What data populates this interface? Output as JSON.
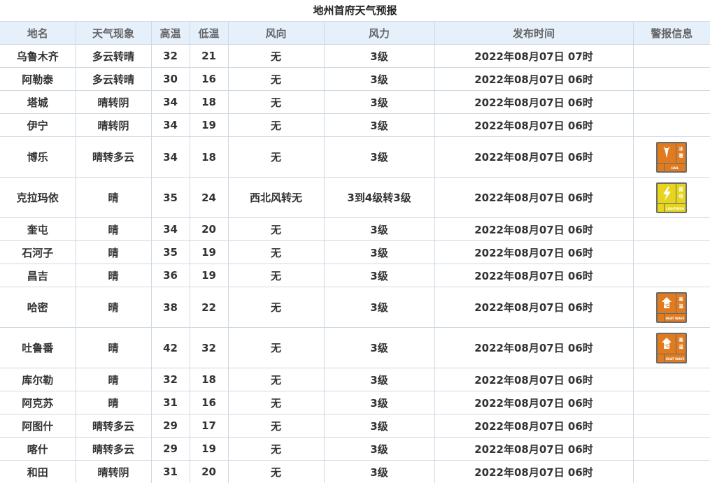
{
  "title": "地州首府天气预报",
  "columns": [
    "地名",
    "天气现象",
    "高温",
    "低温",
    "风向",
    "风力",
    "发布时间",
    "警报信息"
  ],
  "rows": [
    {
      "place": "乌鲁木齐",
      "weather": "多云转晴",
      "high": "32",
      "low": "21",
      "wind_dir": "无",
      "wind_force": "3级",
      "time": "2022年08月07日 07时",
      "alert": null
    },
    {
      "place": "阿勒泰",
      "weather": "多云转晴",
      "high": "30",
      "low": "16",
      "wind_dir": "无",
      "wind_force": "3级",
      "time": "2022年08月07日 06时",
      "alert": null
    },
    {
      "place": "塔城",
      "weather": "晴转阴",
      "high": "34",
      "low": "18",
      "wind_dir": "无",
      "wind_force": "3级",
      "time": "2022年08月07日 06时",
      "alert": null
    },
    {
      "place": "伊宁",
      "weather": "晴转阴",
      "high": "34",
      "low": "19",
      "wind_dir": "无",
      "wind_force": "3级",
      "time": "2022年08月07日 06时",
      "alert": null
    },
    {
      "place": "博乐",
      "weather": "晴转多云",
      "high": "34",
      "low": "18",
      "wind_dir": "无",
      "wind_force": "3级",
      "time": "2022年08月07日 06时",
      "alert": {
        "icon": "hail-warning-icon",
        "top": "冰雹",
        "bottom": "HAIL",
        "color": "#e07b1f"
      }
    },
    {
      "place": "克拉玛依",
      "weather": "晴",
      "high": "35",
      "low": "24",
      "wind_dir": "西北风转无",
      "wind_force": "3到4级转3级",
      "time": "2022年08月07日 06时",
      "alert": {
        "icon": "thunder-warning-icon",
        "top": "雷电",
        "bottom": "LIGHTNING",
        "color": "#e6d51c"
      }
    },
    {
      "place": "奎屯",
      "weather": "晴",
      "high": "34",
      "low": "20",
      "wind_dir": "无",
      "wind_force": "3级",
      "time": "2022年08月07日 06时",
      "alert": null
    },
    {
      "place": "石河子",
      "weather": "晴",
      "high": "35",
      "low": "19",
      "wind_dir": "无",
      "wind_force": "3级",
      "time": "2022年08月07日 06时",
      "alert": null
    },
    {
      "place": "昌吉",
      "weather": "晴",
      "high": "36",
      "low": "19",
      "wind_dir": "无",
      "wind_force": "3级",
      "time": "2022年08月07日 06时",
      "alert": null
    },
    {
      "place": "哈密",
      "weather": "晴",
      "high": "38",
      "low": "22",
      "wind_dir": "无",
      "wind_force": "3级",
      "time": "2022年08月07日 06时",
      "alert": {
        "icon": "heat-warning-icon",
        "top": "高温",
        "bottom": "HEAT WAVE",
        "color": "#e07b1f"
      }
    },
    {
      "place": "吐鲁番",
      "weather": "晴",
      "high": "42",
      "low": "32",
      "wind_dir": "无",
      "wind_force": "3级",
      "time": "2022年08月07日 06时",
      "alert": {
        "icon": "heat-warning-icon",
        "top": "高温",
        "bottom": "HEAT WAVE",
        "color": "#e07b1f"
      }
    },
    {
      "place": "库尔勒",
      "weather": "晴",
      "high": "32",
      "low": "18",
      "wind_dir": "无",
      "wind_force": "3级",
      "time": "2022年08月07日 06时",
      "alert": null
    },
    {
      "place": "阿克苏",
      "weather": "晴",
      "high": "31",
      "low": "16",
      "wind_dir": "无",
      "wind_force": "3级",
      "time": "2022年08月07日 06时",
      "alert": null
    },
    {
      "place": "阿图什",
      "weather": "晴转多云",
      "high": "29",
      "low": "17",
      "wind_dir": "无",
      "wind_force": "3级",
      "time": "2022年08月07日 06时",
      "alert": null
    },
    {
      "place": "喀什",
      "weather": "晴转多云",
      "high": "29",
      "low": "19",
      "wind_dir": "无",
      "wind_force": "3级",
      "time": "2022年08月07日 06时",
      "alert": null
    },
    {
      "place": "和田",
      "weather": "晴转阴",
      "high": "31",
      "low": "20",
      "wind_dir": "无",
      "wind_force": "3级",
      "time": "2022年08月07日 06时",
      "alert": null
    }
  ]
}
